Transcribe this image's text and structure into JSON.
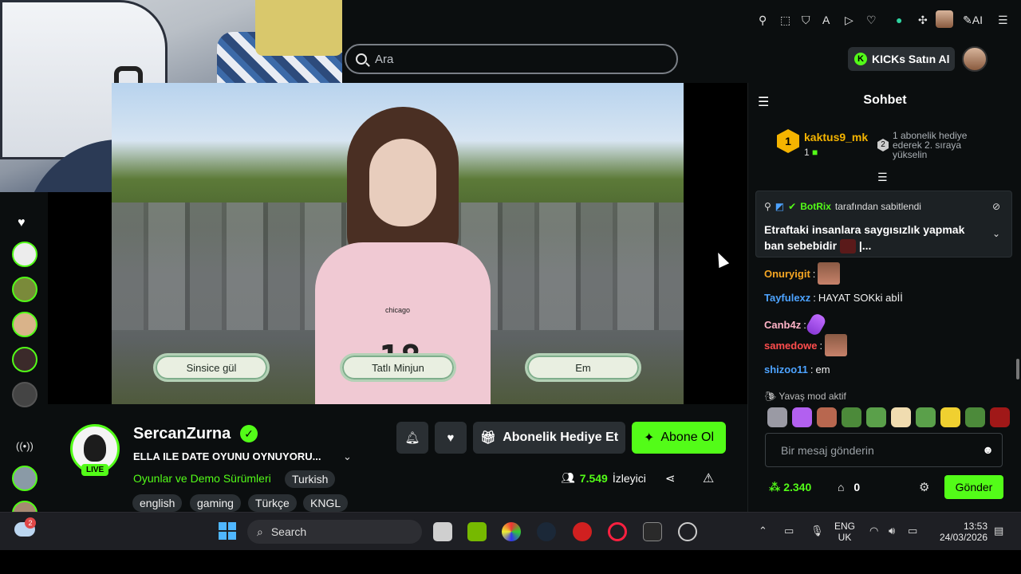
{
  "search": {
    "placeholder": "Ara"
  },
  "browser": {
    "ai_label": "AI",
    "kicks_button": "KICKs Satın Al",
    "kicks_icon_letter": "K"
  },
  "rail": {
    "icons": [
      "heart-icon",
      "live-icon"
    ]
  },
  "video": {
    "choices": [
      "Sinsice gül",
      "Tatlı Minjun",
      "Em"
    ],
    "jersey_number": "18",
    "jersey_text": "chicago"
  },
  "streamer": {
    "name": "SercanZurna",
    "live_badge": "LIVE",
    "title": "ELLA ILE DATE OYUNU OYNUYORU...",
    "category": "Oyunlar ve Demo Sürümleri",
    "language_tag": "Turkish",
    "tags": [
      "english",
      "gaming",
      "Türkçe",
      "KNGL"
    ],
    "viewers": "7.549",
    "viewers_label": "İzleyici",
    "gift_button": "Abonelik Hediye Et",
    "subscribe_button": "Abone Ol"
  },
  "chat": {
    "header": "Sohbet",
    "leader": {
      "rank": "1",
      "name": "kaktus9_mk",
      "count": "1",
      "next_rank": "2",
      "next_text": "1 abonelik hediye ederek 2. sıraya yükselin"
    },
    "pinned": {
      "by_user": "BotRix",
      "by_suffix": "tarafından sabitlendi",
      "message": "Etraftaki insanlara saygısızlık yapmak ban sebebidir",
      "message_tail": "|..."
    },
    "messages": [
      {
        "user": "Onuryigit",
        "color": "#f5a623",
        "text": ""
      },
      {
        "user": "Tayfulexz",
        "color": "#4da3ff",
        "text": "HAYAT SOKki abİİ"
      },
      {
        "user": "Canb4z",
        "color": "#ffb3c7",
        "text": ""
      },
      {
        "user": "samedowe",
        "color": "#ff4d4d",
        "text": ""
      },
      {
        "user": "shizoo11",
        "color": "#4da3ff",
        "text": "em"
      }
    ],
    "slow_mode": "Yavaş mod aktif",
    "input_placeholder": "Bir mesaj gönderin",
    "points": "2.340",
    "store_count": "0",
    "send_button": "Gönder"
  },
  "taskbar": {
    "weather_badge": "2",
    "search_label": "Search",
    "lang_top": "ENG",
    "lang_bottom": "UK",
    "time": "13:53",
    "date": "24/03/2026"
  },
  "colors": {
    "accent": "#53fc18",
    "background": "#0b0e0f",
    "button_gray": "#2a2f33"
  }
}
